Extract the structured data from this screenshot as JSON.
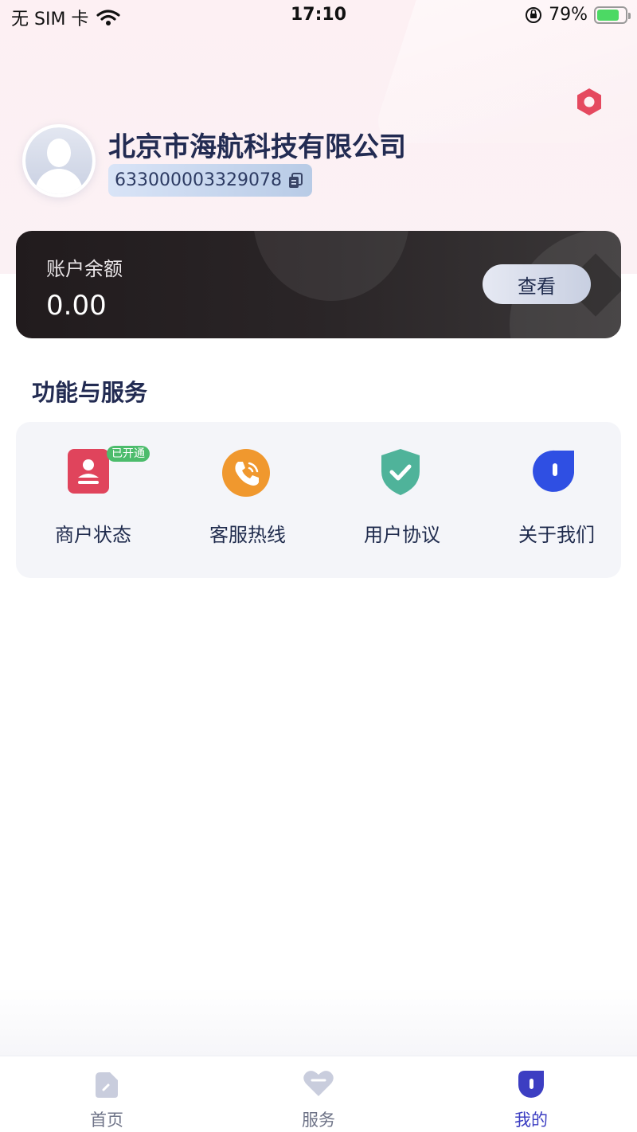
{
  "status_bar": {
    "carrier": "无 SIM 卡",
    "time": "17:10",
    "battery": "79%",
    "battery_level": 0.79
  },
  "profile": {
    "company_name": "北京市海航科技有限公司",
    "merchant_id": "633000003329078"
  },
  "balance": {
    "label": "账户余额",
    "amount": "0.00",
    "view_button": "查看"
  },
  "services": {
    "title": "功能与服务",
    "items": [
      {
        "label": "商户状态",
        "icon": "merchant-status-icon",
        "badge": "已开通",
        "color": "#e0445c"
      },
      {
        "label": "客服热线",
        "icon": "phone-icon",
        "color": "#f0982e"
      },
      {
        "label": "用户协议",
        "icon": "shield-check-icon",
        "color": "#4fb39a"
      },
      {
        "label": "关于我们",
        "icon": "info-icon",
        "color": "#2f4fe3"
      }
    ]
  },
  "tabs": [
    {
      "label": "首页",
      "icon": "home-icon",
      "active": false
    },
    {
      "label": "服务",
      "icon": "heart-icon",
      "active": false
    },
    {
      "label": "我的",
      "icon": "profile-icon",
      "active": true
    }
  ],
  "colors": {
    "accent": "#3c3ec2",
    "settings": "#e5495f",
    "badge": "#4cbc6c",
    "card_dark": "#211b1d"
  }
}
